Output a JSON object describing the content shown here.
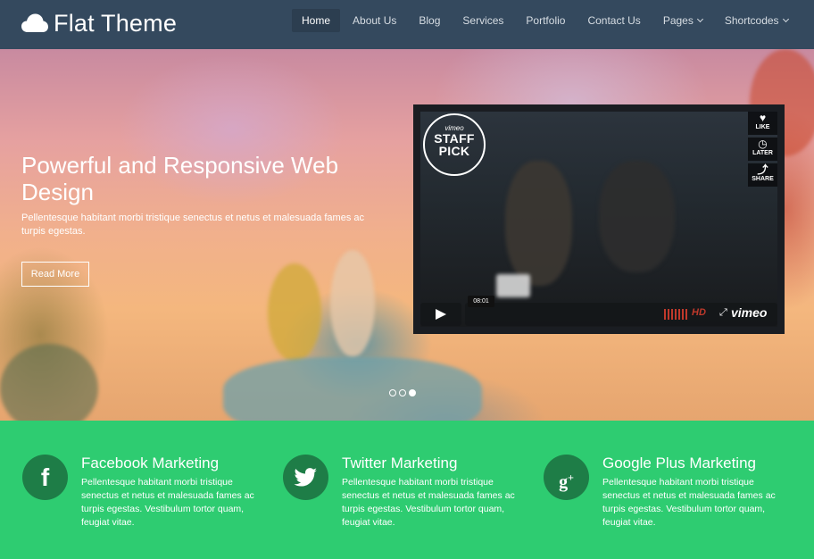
{
  "brand": {
    "name": "Flat Theme",
    "icon": "cloud-icon"
  },
  "nav": {
    "items": [
      {
        "label": "Home",
        "active": true
      },
      {
        "label": "About Us"
      },
      {
        "label": "Blog"
      },
      {
        "label": "Services"
      },
      {
        "label": "Portfolio"
      },
      {
        "label": "Contact Us"
      },
      {
        "label": "Pages",
        "dropdown": true
      },
      {
        "label": "Shortcodes",
        "dropdown": true
      }
    ]
  },
  "hero": {
    "title": "Powerful and Responsive Web Design",
    "text": "Pellentesque habitant morbi tristique senectus et netus et malesuada fames ac turpis egestas.",
    "button": "Read More",
    "slides": 3,
    "active_slide": 3
  },
  "video": {
    "badge_top": "vimeo",
    "badge_main": "STAFF PICK",
    "like": "LIKE",
    "later": "LATER",
    "share": "SHARE",
    "duration": "08:01",
    "hd": "HD",
    "logo": "vimeo"
  },
  "features": [
    {
      "icon": "facebook-icon",
      "title": "Facebook Marketing",
      "text": "Pellentesque habitant morbi tristique senectus et netus et malesuada fames ac turpis egestas. Vestibulum tortor quam, feugiat vitae."
    },
    {
      "icon": "twitter-icon",
      "title": "Twitter Marketing",
      "text": "Pellentesque habitant morbi tristique senectus et netus et malesuada fames ac turpis egestas. Vestibulum tortor quam, feugiat vitae."
    },
    {
      "icon": "google-plus-icon",
      "title": "Google Plus Marketing",
      "text": "Pellentesque habitant morbi tristique senectus et netus et malesuada fames ac turpis egestas. Vestibulum tortor quam, feugiat vitae."
    }
  ],
  "colors": {
    "navbar": "#34495e",
    "nav_active": "#2c3e50",
    "features_bg": "#2ecc71",
    "icon_circle": "#1e7d47"
  }
}
